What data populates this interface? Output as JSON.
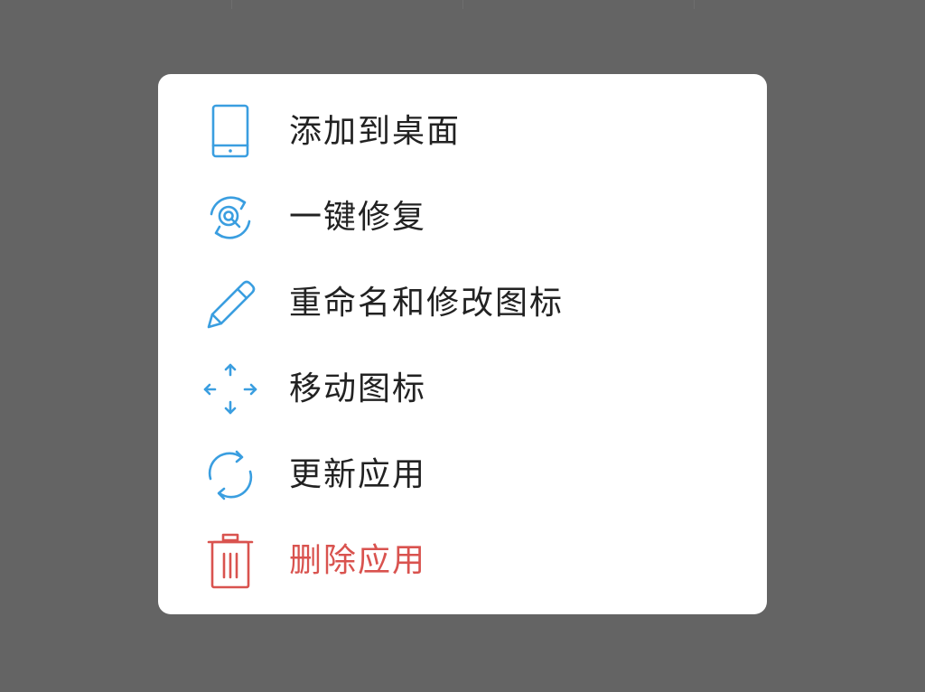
{
  "menu": {
    "items": [
      {
        "label": "添加到桌面",
        "icon": "tablet-icon"
      },
      {
        "label": "一键修复",
        "icon": "repair-icon"
      },
      {
        "label": "重命名和修改图标",
        "icon": "pencil-icon"
      },
      {
        "label": "移动图标",
        "icon": "move-arrows-icon"
      },
      {
        "label": "更新应用",
        "icon": "refresh-icon"
      },
      {
        "label": "删除应用",
        "icon": "trash-icon"
      }
    ]
  },
  "colors": {
    "icon_blue": "#3a9ee0",
    "danger_red": "#d9534f",
    "text": "#222222",
    "backdrop": "#646464",
    "panel": "#ffffff"
  }
}
